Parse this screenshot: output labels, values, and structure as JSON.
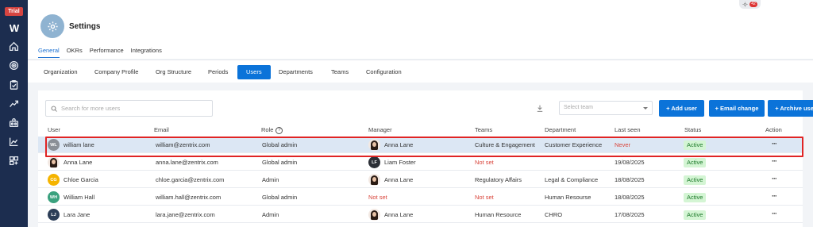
{
  "sidebar": {
    "trial_label": "Trial",
    "logo": "W",
    "icons": [
      "home-icon",
      "target-icon",
      "clipboard-check-icon",
      "trend-icon",
      "team-icon",
      "chart-icon",
      "apps-add-icon"
    ]
  },
  "header": {
    "title": "Settings",
    "notification_count": "42"
  },
  "top_tabs": [
    {
      "label": "General",
      "active": true
    },
    {
      "label": "OKRs",
      "active": false
    },
    {
      "label": "Performance",
      "active": false
    },
    {
      "label": "Integrations",
      "active": false
    }
  ],
  "sub_tabs": [
    {
      "label": "Organization"
    },
    {
      "label": "Company Profile"
    },
    {
      "label": "Org Structure"
    },
    {
      "label": "Periods"
    },
    {
      "label": "Users",
      "active": true
    },
    {
      "label": "Departments"
    },
    {
      "label": "Teams"
    },
    {
      "label": "Configuration"
    }
  ],
  "toolbar": {
    "search_placeholder": "Search for more users",
    "team_placeholder": "Select team",
    "add_user": "+ Add user",
    "email_change": "+ Email change",
    "archive_user": "+ Archive user"
  },
  "table": {
    "headers": {
      "user": "User",
      "email": "Email",
      "role": "Role",
      "role_help": "?",
      "manager": "Manager",
      "teams": "Teams",
      "department": "Department",
      "last_seen": "Last seen",
      "status": "Status",
      "action": "Action"
    },
    "action_label": "···",
    "rows": [
      {
        "avatar": "WL",
        "avatar_color": "#8a8f96",
        "name": "william lane",
        "email": "william@zentrix.com",
        "role": "Global admin",
        "manager_avatar": "photo",
        "manager": "Anna Lane",
        "teams": "Culture & Engagement",
        "teams_notset": false,
        "department": "Customer Experience",
        "last_seen": "Never",
        "last_seen_red": true,
        "status": "Active"
      },
      {
        "avatar": "photo",
        "name": "Anna Lane",
        "email": "anna.lane@zentrix.com",
        "role": "Global admin",
        "manager_avatar": "LF",
        "manager_avatar_color": "#2c2f36",
        "manager": "Liam Foster",
        "teams": "Not set",
        "teams_notset": true,
        "department": "",
        "last_seen": "19/08/2025",
        "status": "Active"
      },
      {
        "avatar": "CG",
        "avatar_color": "#f5b400",
        "name": "Chloe Garcia",
        "email": "chloe.garcia@zentrix.com",
        "role": "Admin",
        "manager_avatar": "photo",
        "manager": "Anna Lane",
        "teams": "Regulatory Affairs",
        "teams_notset": false,
        "department": "Legal & Compliance",
        "last_seen": "18/08/2025",
        "status": "Active"
      },
      {
        "avatar": "WH",
        "avatar_color": "#3aa17e",
        "name": "William Hall",
        "email": "william.hall@zentrix.com",
        "role": "Global admin",
        "manager_avatar": "",
        "manager": "Not set",
        "manager_notset": true,
        "teams": "Not set",
        "teams_notset": true,
        "department": "Human Resourse",
        "last_seen": "18/08/2025",
        "status": "Active"
      },
      {
        "avatar": "LJ",
        "avatar_color": "#2c3e57",
        "name": "Lara Jane",
        "email": "lara.jane@zentrix.com",
        "role": "Admin",
        "manager_avatar": "photo",
        "manager": "Anna Lane",
        "teams": "Human Resource",
        "teams_notset": false,
        "department": "CHRO",
        "last_seen": "17/08/2025",
        "status": "Active"
      }
    ]
  }
}
